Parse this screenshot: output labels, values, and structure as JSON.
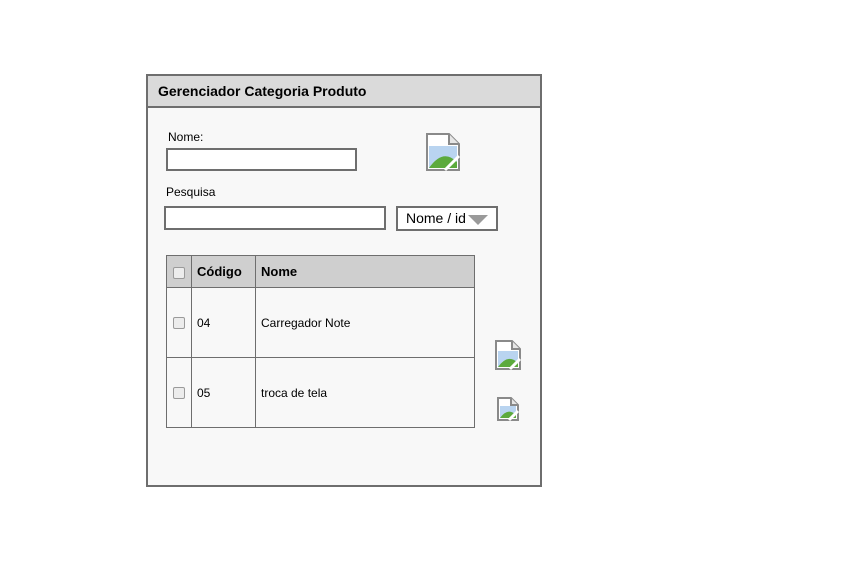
{
  "panel": {
    "title": "Gerenciador Categoria Produto"
  },
  "form": {
    "name_label": "Nome:",
    "name_value": "",
    "search_label": "Pesquisa",
    "search_value": "",
    "filter_selected": "Nome / id"
  },
  "table": {
    "columns": [
      "Código",
      "Nome"
    ],
    "rows": [
      {
        "code": "04",
        "name": "Carregador Note"
      },
      {
        "code": "05",
        "name": "troca de tela"
      }
    ]
  },
  "icons": {
    "header_image": "broken-image-icon",
    "row_action_1": "broken-image-icon",
    "row_action_2": "broken-image-icon"
  }
}
